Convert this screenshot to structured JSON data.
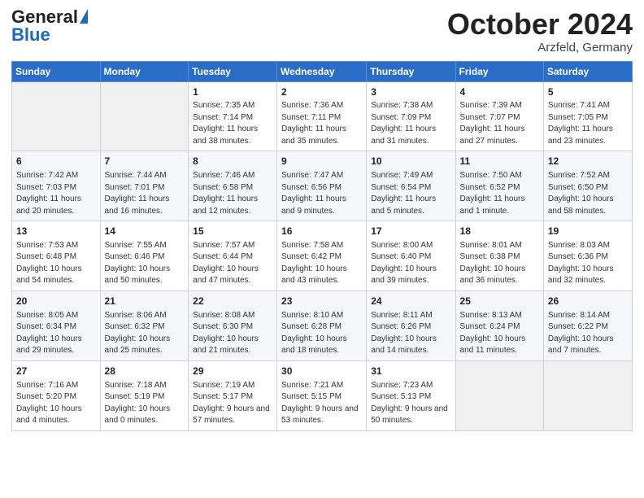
{
  "logo": {
    "general": "General",
    "blue": "Blue"
  },
  "title": "October 2024",
  "location": "Arzfeld, Germany",
  "days_header": [
    "Sunday",
    "Monday",
    "Tuesday",
    "Wednesday",
    "Thursday",
    "Friday",
    "Saturday"
  ],
  "weeks": [
    [
      {
        "num": "",
        "info": "",
        "empty": true
      },
      {
        "num": "",
        "info": "",
        "empty": true
      },
      {
        "num": "1",
        "info": "Sunrise: 7:35 AM\nSunset: 7:14 PM\nDaylight: 11 hours and 38 minutes."
      },
      {
        "num": "2",
        "info": "Sunrise: 7:36 AM\nSunset: 7:11 PM\nDaylight: 11 hours and 35 minutes."
      },
      {
        "num": "3",
        "info": "Sunrise: 7:38 AM\nSunset: 7:09 PM\nDaylight: 11 hours and 31 minutes."
      },
      {
        "num": "4",
        "info": "Sunrise: 7:39 AM\nSunset: 7:07 PM\nDaylight: 11 hours and 27 minutes."
      },
      {
        "num": "5",
        "info": "Sunrise: 7:41 AM\nSunset: 7:05 PM\nDaylight: 11 hours and 23 minutes."
      }
    ],
    [
      {
        "num": "6",
        "info": "Sunrise: 7:42 AM\nSunset: 7:03 PM\nDaylight: 11 hours and 20 minutes."
      },
      {
        "num": "7",
        "info": "Sunrise: 7:44 AM\nSunset: 7:01 PM\nDaylight: 11 hours and 16 minutes."
      },
      {
        "num": "8",
        "info": "Sunrise: 7:46 AM\nSunset: 6:58 PM\nDaylight: 11 hours and 12 minutes."
      },
      {
        "num": "9",
        "info": "Sunrise: 7:47 AM\nSunset: 6:56 PM\nDaylight: 11 hours and 9 minutes."
      },
      {
        "num": "10",
        "info": "Sunrise: 7:49 AM\nSunset: 6:54 PM\nDaylight: 11 hours and 5 minutes."
      },
      {
        "num": "11",
        "info": "Sunrise: 7:50 AM\nSunset: 6:52 PM\nDaylight: 11 hours and 1 minute."
      },
      {
        "num": "12",
        "info": "Sunrise: 7:52 AM\nSunset: 6:50 PM\nDaylight: 10 hours and 58 minutes."
      }
    ],
    [
      {
        "num": "13",
        "info": "Sunrise: 7:53 AM\nSunset: 6:48 PM\nDaylight: 10 hours and 54 minutes."
      },
      {
        "num": "14",
        "info": "Sunrise: 7:55 AM\nSunset: 6:46 PM\nDaylight: 10 hours and 50 minutes."
      },
      {
        "num": "15",
        "info": "Sunrise: 7:57 AM\nSunset: 6:44 PM\nDaylight: 10 hours and 47 minutes."
      },
      {
        "num": "16",
        "info": "Sunrise: 7:58 AM\nSunset: 6:42 PM\nDaylight: 10 hours and 43 minutes."
      },
      {
        "num": "17",
        "info": "Sunrise: 8:00 AM\nSunset: 6:40 PM\nDaylight: 10 hours and 39 minutes."
      },
      {
        "num": "18",
        "info": "Sunrise: 8:01 AM\nSunset: 6:38 PM\nDaylight: 10 hours and 36 minutes."
      },
      {
        "num": "19",
        "info": "Sunrise: 8:03 AM\nSunset: 6:36 PM\nDaylight: 10 hours and 32 minutes."
      }
    ],
    [
      {
        "num": "20",
        "info": "Sunrise: 8:05 AM\nSunset: 6:34 PM\nDaylight: 10 hours and 29 minutes."
      },
      {
        "num": "21",
        "info": "Sunrise: 8:06 AM\nSunset: 6:32 PM\nDaylight: 10 hours and 25 minutes."
      },
      {
        "num": "22",
        "info": "Sunrise: 8:08 AM\nSunset: 6:30 PM\nDaylight: 10 hours and 21 minutes."
      },
      {
        "num": "23",
        "info": "Sunrise: 8:10 AM\nSunset: 6:28 PM\nDaylight: 10 hours and 18 minutes."
      },
      {
        "num": "24",
        "info": "Sunrise: 8:11 AM\nSunset: 6:26 PM\nDaylight: 10 hours and 14 minutes."
      },
      {
        "num": "25",
        "info": "Sunrise: 8:13 AM\nSunset: 6:24 PM\nDaylight: 10 hours and 11 minutes."
      },
      {
        "num": "26",
        "info": "Sunrise: 8:14 AM\nSunset: 6:22 PM\nDaylight: 10 hours and 7 minutes."
      }
    ],
    [
      {
        "num": "27",
        "info": "Sunrise: 7:16 AM\nSunset: 5:20 PM\nDaylight: 10 hours and 4 minutes."
      },
      {
        "num": "28",
        "info": "Sunrise: 7:18 AM\nSunset: 5:19 PM\nDaylight: 10 hours and 0 minutes."
      },
      {
        "num": "29",
        "info": "Sunrise: 7:19 AM\nSunset: 5:17 PM\nDaylight: 9 hours and 57 minutes."
      },
      {
        "num": "30",
        "info": "Sunrise: 7:21 AM\nSunset: 5:15 PM\nDaylight: 9 hours and 53 minutes."
      },
      {
        "num": "31",
        "info": "Sunrise: 7:23 AM\nSunset: 5:13 PM\nDaylight: 9 hours and 50 minutes."
      },
      {
        "num": "",
        "info": "",
        "empty": true
      },
      {
        "num": "",
        "info": "",
        "empty": true
      }
    ]
  ]
}
